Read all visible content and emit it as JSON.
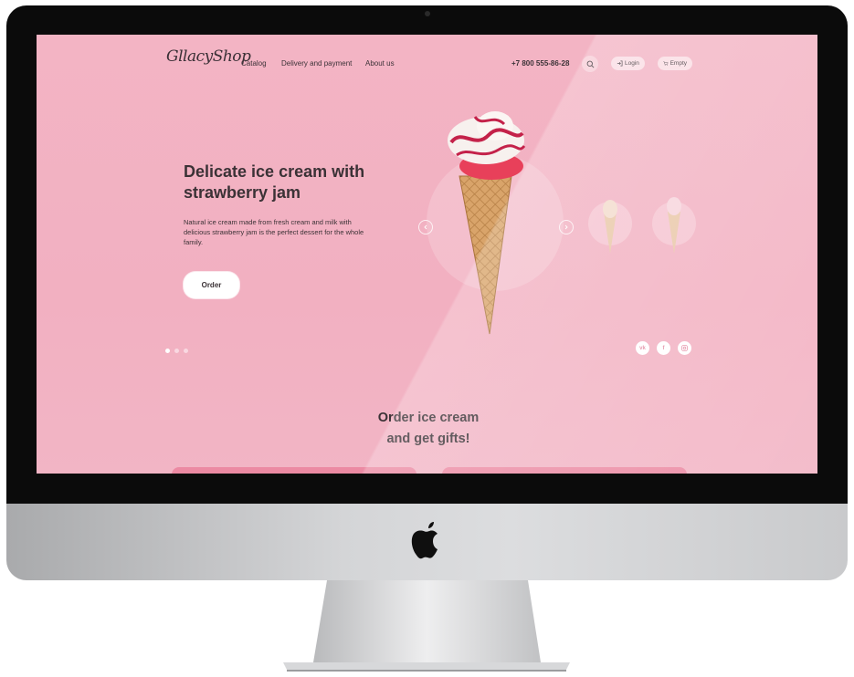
{
  "site": {
    "logo": "GllacyShop",
    "nav": [
      "Catalog",
      "Delivery and payment",
      "About us"
    ],
    "phone": "+7 800 555-86-28",
    "login_label": "Login",
    "cart_label": "Empty"
  },
  "hero": {
    "title": "Delicate ice cream with strawberry jam",
    "description": "Natural ice cream made from fresh cream and milk with delicious strawberry jam is the perfect dessert for the whole family.",
    "order_label": "Order",
    "slides_total": 3,
    "slide_active": 1
  },
  "social_icons": [
    "vk-icon",
    "facebook-icon",
    "instagram-icon"
  ],
  "section": {
    "title_line1": "Order ice cream",
    "title_line2": "and get gifts!"
  },
  "colors": {
    "background": "#f2b0c1",
    "text": "#3b3236",
    "accent": "#ec8aa3"
  }
}
